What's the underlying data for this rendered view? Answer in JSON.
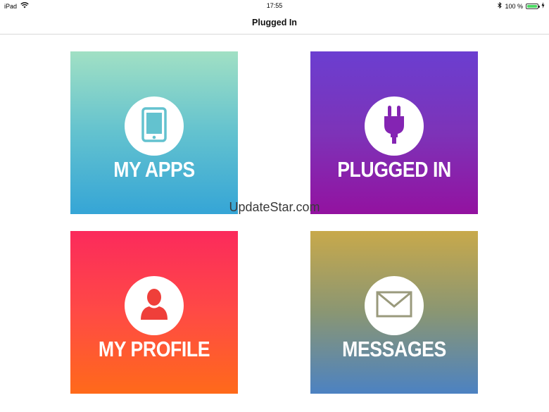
{
  "status_bar": {
    "device": "iPad",
    "time": "17:55",
    "battery_text": "100 %",
    "battery_level": 1.0,
    "icons": [
      "wifi-icon",
      "bluetooth-icon",
      "battery-icon",
      "charging-icon"
    ]
  },
  "nav": {
    "title": "Plugged In"
  },
  "tiles": [
    {
      "label": "MY APPS",
      "icon": "tablet-icon",
      "colors": [
        "#a1e0c4",
        "#35a5d6"
      ]
    },
    {
      "label": "PLUGGED IN",
      "icon": "plug-icon",
      "colors": [
        "#6b3ed0",
        "#9312a0"
      ]
    },
    {
      "label": "MY PROFILE",
      "icon": "person-icon",
      "colors": [
        "#fb2a5c",
        "#ff6a1a"
      ]
    },
    {
      "label": "MESSAGES",
      "icon": "envelope-icon",
      "colors": [
        "#c8a94b",
        "#4c82c2"
      ]
    }
  ],
  "watermark": "UpdateStar.com"
}
